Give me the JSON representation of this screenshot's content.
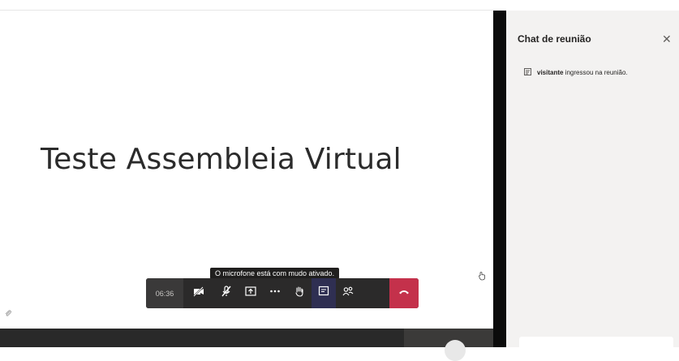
{
  "meeting": {
    "slide_title": "Teste Assembleia Virtual"
  },
  "chat": {
    "title": "Chat de reunião",
    "close_icon": "close-icon",
    "system_message": {
      "user": "visitante",
      "text": "ingressou na reunião."
    }
  },
  "controls": {
    "timer": "06:36",
    "tooltip": "O microfone está com mudo ativado.",
    "buttons": [
      {
        "name": "camera-off",
        "icon": "camera-off-icon"
      },
      {
        "name": "mic-muted",
        "icon": "mic-off-icon"
      },
      {
        "name": "share-screen",
        "icon": "share-icon"
      },
      {
        "name": "more-actions",
        "icon": "ellipsis-icon"
      },
      {
        "name": "raise-hand",
        "icon": "hand-icon"
      },
      {
        "name": "chat",
        "icon": "chat-icon",
        "active": true
      },
      {
        "name": "participants",
        "icon": "people-icon"
      },
      {
        "name": "hang-up",
        "icon": "phone-hangup-icon"
      }
    ],
    "colors": {
      "hangup": "#c4314b",
      "toolbar": "#2b2a2a",
      "active": "#2f2f52"
    }
  }
}
